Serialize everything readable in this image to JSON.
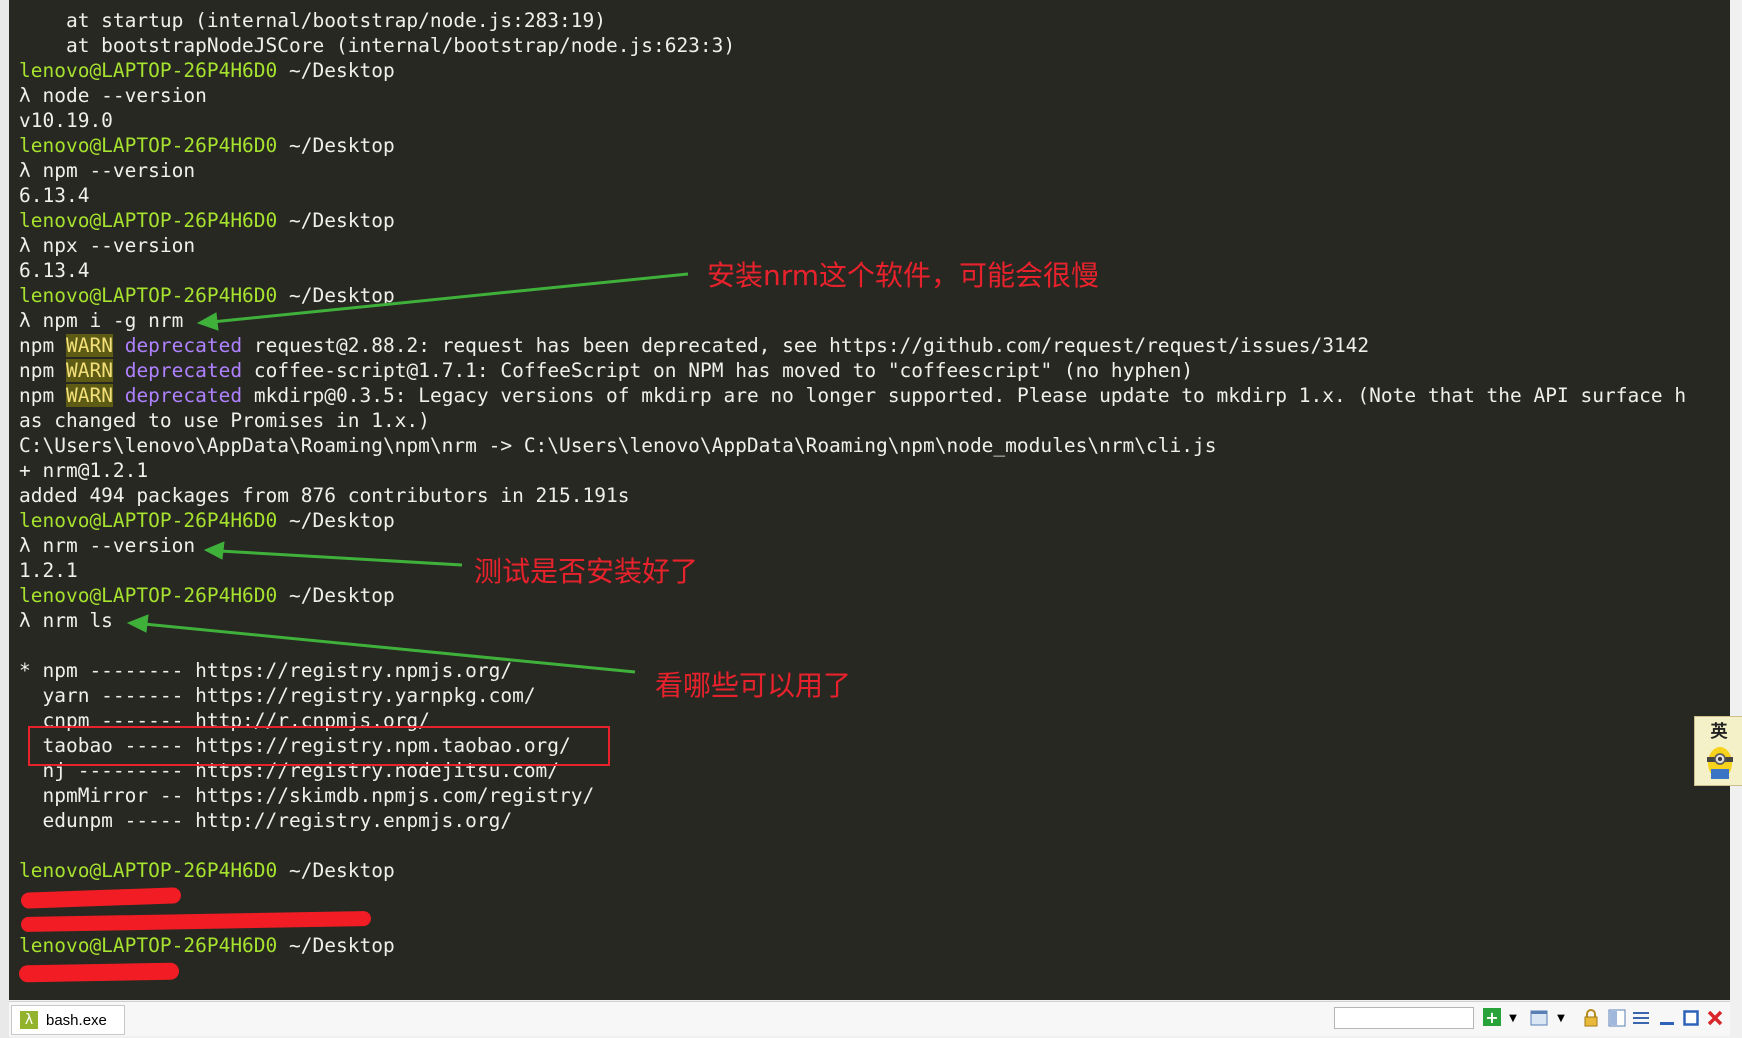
{
  "terminal": {
    "lines": [
      {
        "text": "    at startup (internal/bootstrap/node.js:283:19)"
      },
      {
        "text": "    at bootstrapNodeJSCore (internal/bootstrap/node.js:623:3)"
      },
      {
        "prompt": "lenovo@LAPTOP-26P4H6D0",
        "path": "~/Desktop"
      },
      {
        "text": "λ node --version"
      },
      {
        "text": "v10.19.0"
      },
      {
        "prompt": "lenovo@LAPTOP-26P4H6D0",
        "path": "~/Desktop"
      },
      {
        "text": "λ npm --version"
      },
      {
        "text": "6.13.4"
      },
      {
        "prompt": "lenovo@LAPTOP-26P4H6D0",
        "path": "~/Desktop"
      },
      {
        "text": "λ npx --version"
      },
      {
        "text": "6.13.4"
      },
      {
        "prompt": "lenovo@LAPTOP-26P4H6D0",
        "path": "~/Desktop"
      },
      {
        "text": "λ npm i -g nrm"
      },
      {
        "npm": "npm",
        "warn": "WARN",
        "dep": "deprecated",
        "msg": "request@2.88.2: request has been deprecated, see https://github.com/request/request/issues/3142"
      },
      {
        "npm": "npm",
        "warn": "WARN",
        "dep": "deprecated",
        "msg": "coffee-script@1.7.1: CoffeeScript on NPM has moved to \"coffeescript\" (no hyphen)"
      },
      {
        "npm": "npm",
        "warn": "WARN",
        "dep": "deprecated",
        "msg": "mkdirp@0.3.5: Legacy versions of mkdirp are no longer supported. Please update to mkdirp 1.x. (Note that the API surface h"
      },
      {
        "text": "as changed to use Promises in 1.x.)"
      },
      {
        "text": "C:\\Users\\lenovo\\AppData\\Roaming\\npm\\nrm -> C:\\Users\\lenovo\\AppData\\Roaming\\npm\\node_modules\\nrm\\cli.js"
      },
      {
        "text": "+ nrm@1.2.1"
      },
      {
        "text": "added 494 packages from 876 contributors in 215.191s"
      },
      {
        "prompt": "lenovo@LAPTOP-26P4H6D0",
        "path": "~/Desktop"
      },
      {
        "text": "λ nrm --version"
      },
      {
        "text": "1.2.1"
      },
      {
        "prompt": "lenovo@LAPTOP-26P4H6D0",
        "path": "~/Desktop"
      },
      {
        "text": "λ nrm ls"
      },
      {
        "text": ""
      },
      {
        "text": "* npm -------- https://registry.npmjs.org/"
      },
      {
        "text": "  yarn ------- https://registry.yarnpkg.com/"
      },
      {
        "text": "  cnpm ------- http://r.cnpmjs.org/"
      },
      {
        "text": "  taobao ----- https://registry.npm.taobao.org/"
      },
      {
        "text": "  nj --------- https://registry.nodejitsu.com/"
      },
      {
        "text": "  npmMirror -- https://skimdb.npmjs.com/registry/"
      },
      {
        "text": "  edunpm ----- http://registry.enpmjs.org/"
      },
      {
        "text": ""
      },
      {
        "prompt": "lenovo@LAPTOP-26P4H6D0",
        "path": "~/Desktop"
      },
      {
        "text": ""
      },
      {
        "text": ""
      },
      {
        "prompt": "lenovo@LAPTOP-26P4H6D0",
        "path": "~/Desktop"
      }
    ]
  },
  "annotations": {
    "install_note": "安装nrm这个软件，可能会很慢",
    "test_note": "测试是否安装好了",
    "list_note": "看哪些可以用了"
  },
  "ime": {
    "label": "英"
  },
  "taskbar": {
    "tab_label": "bash.exe",
    "tab_icon": "λ"
  },
  "colors": {
    "background": "#272822",
    "prompt": "#a6e22e",
    "warn_bg": "#5e5b14",
    "deprecated": "#ae81ff",
    "annotation": "#e8222c"
  },
  "icons": [
    "bash-icon",
    "add-icon",
    "dropdown-icon",
    "window-icon",
    "lock-icon",
    "split-icon",
    "menu-icon",
    "minimize-icon",
    "maximize-icon",
    "close-icon"
  ]
}
